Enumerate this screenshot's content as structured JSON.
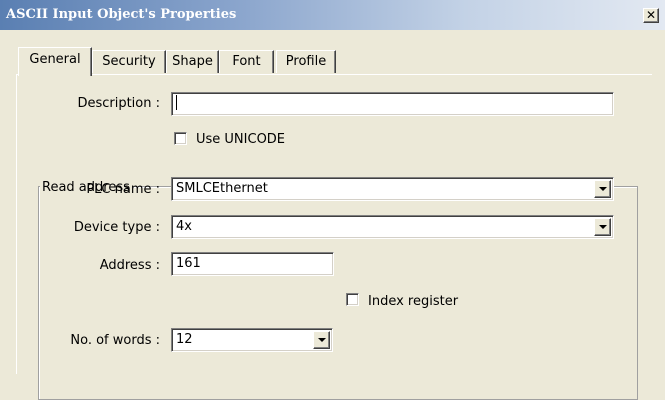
{
  "window": {
    "title": "ASCII Input Object's Properties",
    "close_glyph": "✕"
  },
  "tabs": [
    {
      "label": "General",
      "active": true
    },
    {
      "label": "Security",
      "active": false
    },
    {
      "label": "Shape",
      "active": false
    },
    {
      "label": "Font",
      "active": false
    },
    {
      "label": "Profile",
      "active": false
    }
  ],
  "general": {
    "description_label": "Description :",
    "description_value": "",
    "use_unicode_label": "Use UNICODE",
    "use_unicode_checked": false,
    "read_address": {
      "group_label": "Read address",
      "plc_name_label": "PLC name :",
      "plc_name_value": "SMLCEthernet",
      "device_type_label": "Device type :",
      "device_type_value": "4x",
      "address_label": "Address :",
      "address_value": "161",
      "index_register_label": "Index register",
      "index_register_checked": false,
      "words_label": "No. of words :",
      "words_value": "12"
    }
  }
}
